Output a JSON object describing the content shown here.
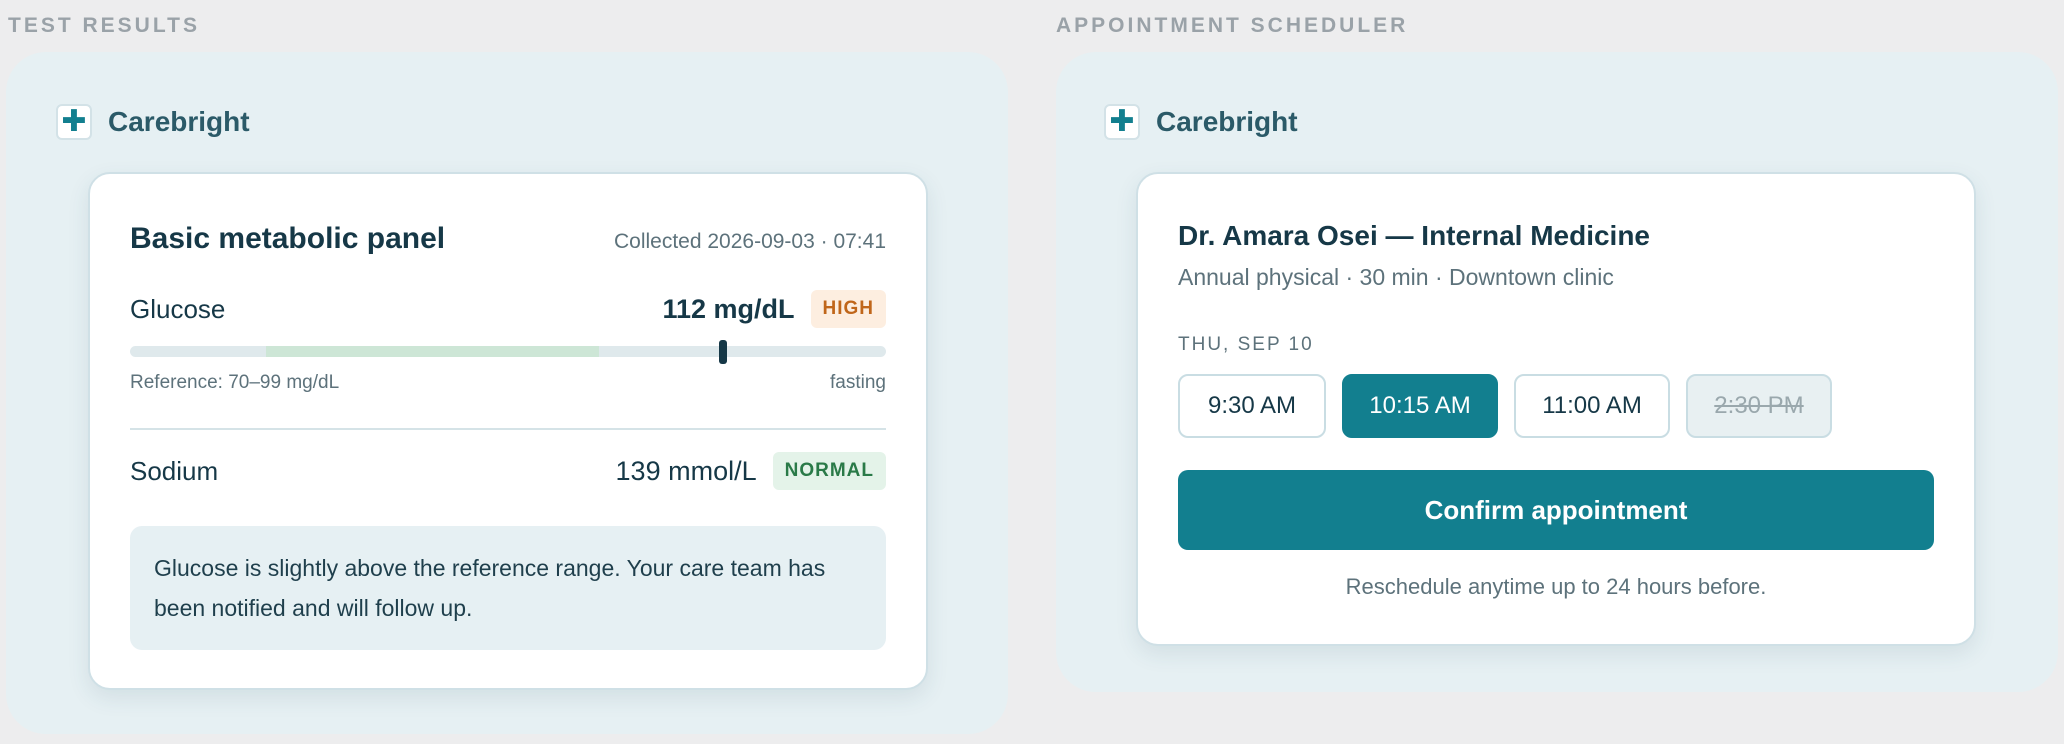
{
  "test_results": {
    "section_label": "TEST RESULTS",
    "brand": {
      "mark": "✚",
      "name": "Carebright"
    },
    "card": {
      "title": "Basic metabolic panel",
      "collected": "Collected 2026-09-03 · 07:41",
      "glucose": {
        "name": "Glucose",
        "value": "112 mg/dL",
        "badge": "HIGH",
        "reference": "Reference: 70–99 mg/dL",
        "condition": "fasting",
        "range_normal_start_pct": 18,
        "range_normal_end_pct": 62,
        "marker_pct": 78.5
      },
      "sodium": {
        "name": "Sodium",
        "value": "139 mmol/L",
        "badge": "NORMAL"
      },
      "note": "Glucose is slightly above the reference range. Your care team has been notified and will follow up."
    }
  },
  "scheduler": {
    "section_label": "APPOINTMENT SCHEDULER",
    "brand": {
      "mark": "✚",
      "name": "Carebright"
    },
    "card": {
      "doctor": "Dr. Amara Osei — Internal Medicine",
      "details": "Annual physical · 30 min · Downtown clinic",
      "day": "THU, SEP 10",
      "slots": [
        {
          "label": "9:30 AM",
          "state": "available"
        },
        {
          "label": "10:15 AM",
          "state": "selected"
        },
        {
          "label": "11:00 AM",
          "state": "available"
        },
        {
          "label": "2:30 PM",
          "state": "disabled"
        }
      ],
      "confirm_label": "Confirm appointment",
      "footnote": "Reschedule anytime up to 24 hours before."
    }
  },
  "colors": {
    "accent": "#127f8f",
    "high": "#c0661a",
    "normal": "#2a7a48"
  }
}
